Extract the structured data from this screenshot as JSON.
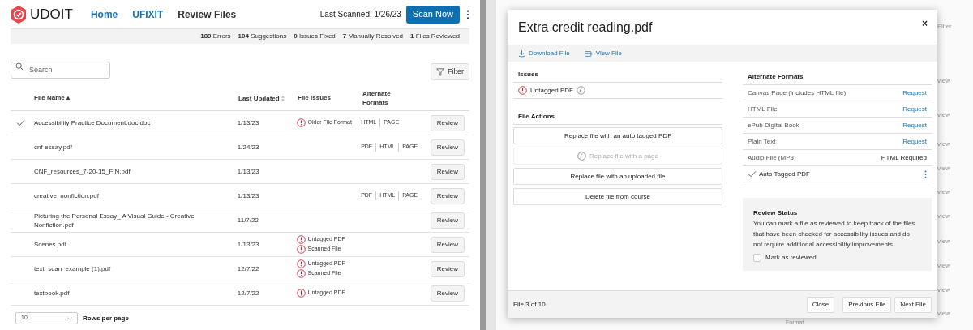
{
  "header": {
    "logo": "UDOIT",
    "nav": [
      {
        "label": "Home",
        "selected": false
      },
      {
        "label": "UFIXIT",
        "selected": false
      },
      {
        "label": "Review Files",
        "selected": true
      }
    ],
    "last_scanned": "Last Scanned: 1/26/23",
    "scan_button": "Scan Now"
  },
  "stats": [
    {
      "count": "189",
      "label": "Errors"
    },
    {
      "count": "104",
      "label": "Suggestions"
    },
    {
      "count": "0",
      "label": "Issues Fixed"
    },
    {
      "count": "7",
      "label": "Manually Resolved"
    },
    {
      "count": "1",
      "label": "Files Reviewed"
    }
  ],
  "search": {
    "placeholder": "Search"
  },
  "filter_button": "Filter",
  "table": {
    "columns": [
      "File Name ▴",
      "Last Updated",
      "File Issues",
      "Alternate Formats"
    ],
    "rows": [
      {
        "reviewed": true,
        "name": "Accessibility Practice Document.doc.doc",
        "updated": "1/13/23",
        "issues": [
          "Older File Format"
        ],
        "formats": [
          "HTML",
          "PAGE"
        ],
        "action": "Review"
      },
      {
        "reviewed": false,
        "name": "cnf-essay.pdf",
        "updated": "1/24/23",
        "issues": [],
        "formats": [
          "PDF",
          "HTML",
          "PAGE"
        ],
        "action": "Review"
      },
      {
        "reviewed": false,
        "name": "CNF_resources_7-20-15_FIN.pdf",
        "updated": "1/13/23",
        "issues": [],
        "formats": [],
        "action": "Review"
      },
      {
        "reviewed": false,
        "name": "creative_nonfiction.pdf",
        "updated": "1/13/23",
        "issues": [],
        "formats": [
          "PDF",
          "HTML",
          "PAGE"
        ],
        "action": "Review"
      },
      {
        "reviewed": false,
        "name": "Picturing the Personal Essay_ A Visual Guide - Creative Nonfiction.pdf",
        "updated": "11/7/22",
        "issues": [],
        "formats": [],
        "action": "Review"
      },
      {
        "reviewed": false,
        "name": "Scenes.pdf",
        "updated": "1/13/23",
        "issues": [
          "Untagged PDF",
          "Scanned File"
        ],
        "formats": [],
        "action": "Review"
      },
      {
        "reviewed": false,
        "name": "text_scan_example (1).pdf",
        "updated": "12/7/22",
        "issues": [
          "Untagged PDF",
          "Scanned File"
        ],
        "formats": [],
        "action": "Review"
      },
      {
        "reviewed": false,
        "name": "textbook.pdf",
        "updated": "12/7/22",
        "issues": [
          "Untagged PDF"
        ],
        "formats": [],
        "action": "Review"
      }
    ]
  },
  "pagination": {
    "rows_value": "10",
    "rows_label": "Rows per page"
  },
  "background": {
    "filter": "Filter",
    "fragments": [
      "view",
      "view",
      "view",
      "view",
      "view",
      "view",
      "view",
      "view",
      "view",
      "view"
    ],
    "format": "Format"
  },
  "modal": {
    "title": "Extra credit reading.pdf",
    "close": "×",
    "toolbar": [
      {
        "kind": "download",
        "label": "Download File"
      },
      {
        "kind": "view",
        "label": "View File"
      }
    ],
    "issues_heading": "Issues",
    "issues": [
      "Untagged PDF"
    ],
    "actions_heading": "File Actions",
    "actions": [
      {
        "label": "Replace file with an auto tagged PDF",
        "disabled": false
      },
      {
        "label": "Replace file with a page",
        "disabled": true
      },
      {
        "label": "Replace file with an uploaded file",
        "disabled": false
      },
      {
        "label": "Delete file from course",
        "disabled": false
      }
    ],
    "formats_heading": "Alternate Formats",
    "formats": [
      {
        "kind": "request",
        "name": "Canvas Page (includes HTML file)",
        "action": "Request"
      },
      {
        "kind": "request",
        "name": "HTML File",
        "action": "Request"
      },
      {
        "kind": "request",
        "name": "ePub Digital Book",
        "action": "Request"
      },
      {
        "kind": "request",
        "name": "Plain Text",
        "action": "Request"
      },
      {
        "kind": "status",
        "name": "Audio File (MP3)",
        "action": "HTML Required"
      },
      {
        "kind": "done",
        "name": "Auto Tagged PDF"
      }
    ],
    "review": {
      "heading": "Review Status",
      "text": "You can mark a file as reviewed to keep track of the files that have been checked for accessibility issues and do not require additional accessibility improvements.",
      "checkbox_label": "Mark as reviewed",
      "checked": false
    },
    "footer": {
      "position": "File 3 of 10",
      "buttons": [
        "Close",
        "Previous File",
        "Next File"
      ]
    }
  }
}
